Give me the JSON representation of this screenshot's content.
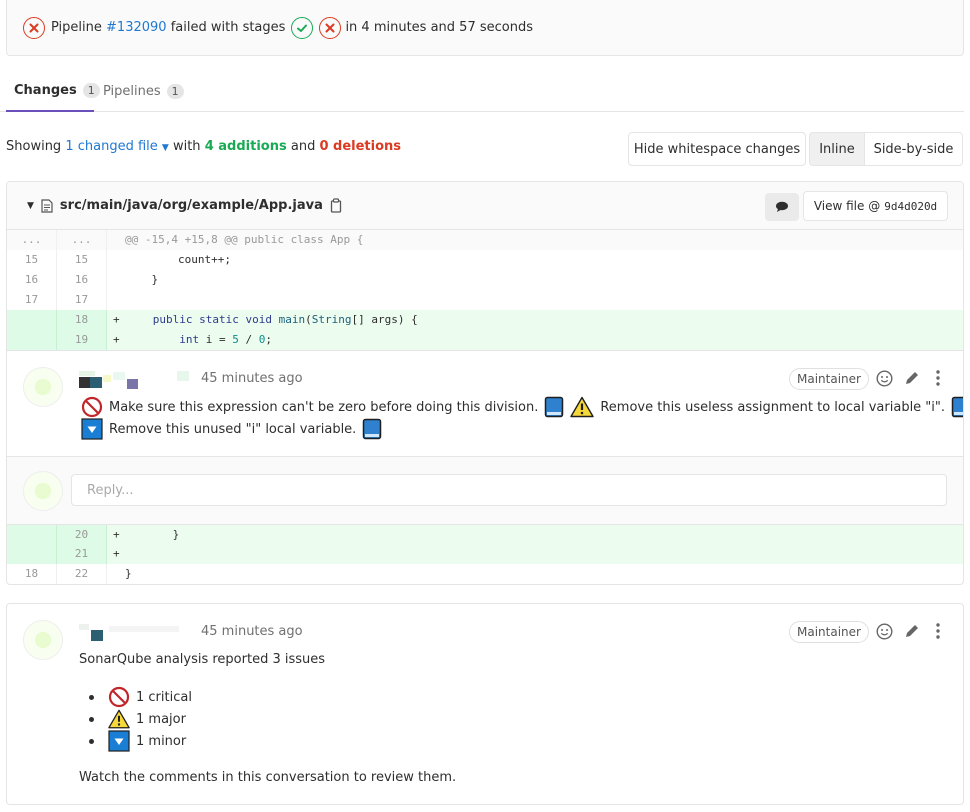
{
  "pipeline": {
    "prefix": "Pipeline",
    "id": "#132090",
    "middle": "failed with stages",
    "suffix": "in 4 minutes and 57 seconds"
  },
  "tabs": [
    {
      "label": "Changes",
      "count": "1",
      "active": true
    },
    {
      "label": "Pipelines",
      "count": "1",
      "active": false
    }
  ],
  "summary": {
    "showing": "Showing",
    "changed": "1 changed file",
    "with": "with",
    "additions": "4 additions",
    "and": "and",
    "deletions": "0 deletions"
  },
  "toolbar": {
    "hide_whitespace": "Hide whitespace changes",
    "inline": "Inline",
    "side_by_side": "Side-by-side"
  },
  "file": {
    "path": "src/main/java/org/example/App.java",
    "view_label": "View file @",
    "commit": "9d4d020d"
  },
  "diff": {
    "hunk_old": "...",
    "hunk_new": "...",
    "hunk": "@@ -15,4 +15,8 @@ public class App {",
    "lines": [
      {
        "old": "15",
        "new": "15",
        "sign": "",
        "code": "        count++;"
      },
      {
        "old": "16",
        "new": "16",
        "sign": "",
        "code": "    }"
      },
      {
        "old": "17",
        "new": "17",
        "sign": "",
        "code": ""
      },
      {
        "old": "",
        "new": "18",
        "sign": "+",
        "code_kw1": "public static void ",
        "code_nm": "main",
        "code_rest": "(",
        "code_nm2": "String",
        "code_end": "[] args) {"
      },
      {
        "old": "",
        "new": "19",
        "sign": "+",
        "code_kw1": "int ",
        "code_rest": "i = ",
        "code_num1": "5",
        "code_mid": " / ",
        "code_num2": "0",
        "code_end": ";"
      }
    ],
    "lines_after": [
      {
        "old": "",
        "new": "20",
        "sign": "+",
        "code": "    }"
      },
      {
        "old": "",
        "new": "21",
        "sign": "+",
        "code": ""
      },
      {
        "old": "18",
        "new": "22",
        "sign": "",
        "code": "}"
      }
    ]
  },
  "comment1": {
    "time": "45 minutes ago",
    "role": "Maintainer",
    "issue1": "Make sure this expression can't be zero before doing this division.",
    "issue2": "Remove this useless assignment to local variable \"i\".",
    "issue3": "Remove this unused \"i\" local variable.",
    "reply_placeholder": "Reply..."
  },
  "comment2": {
    "time": "45 minutes ago",
    "role": "Maintainer",
    "heading": "SonarQube analysis reported 3 issues",
    "items": [
      "1 critical",
      "1 major",
      "1 minor"
    ],
    "footer": "Watch the comments in this conversation to review them."
  },
  "colors": {
    "fail": "#db3b21",
    "success": "#1aaa55",
    "link": "#1f78d1",
    "added_bg": "#ecfdf0",
    "tab_active": "#6b4fbb"
  }
}
